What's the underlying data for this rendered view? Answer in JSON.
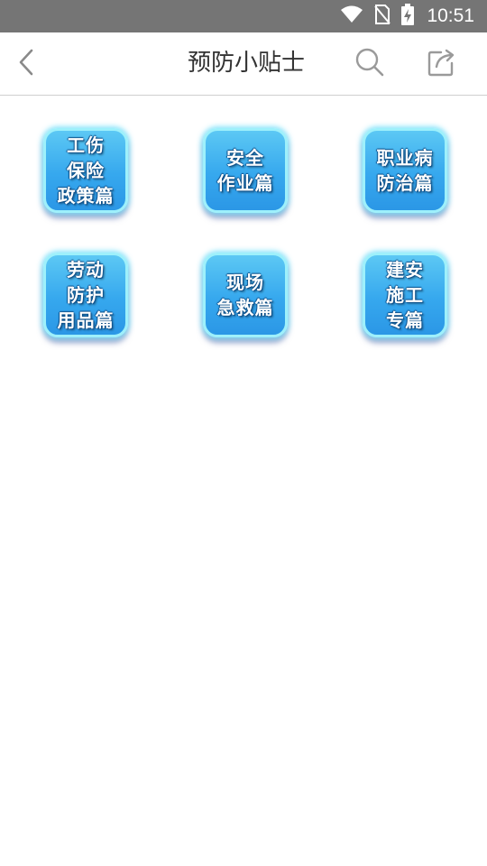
{
  "status_bar": {
    "time": "10:51",
    "icons": [
      "wifi-icon",
      "no-sim-icon",
      "battery-charging-icon"
    ]
  },
  "app_bar": {
    "title": "预防小贴士",
    "icons": [
      "back-chevron-icon",
      "search-icon",
      "share-icon"
    ]
  },
  "categories": [
    {
      "label": "工伤\n保险\n政策篇"
    },
    {
      "label": "安全\n作业篇"
    },
    {
      "label": "职业病\n防治篇"
    },
    {
      "label": "劳动\n防护\n用品篇"
    },
    {
      "label": "现场\n急救篇"
    },
    {
      "label": "建安\n施工\n专篇"
    }
  ],
  "colors": {
    "status_bar": "#757575",
    "tile_fill": "#36a8ee",
    "tile_border": "#9ef0fb",
    "title_text": "#333333"
  }
}
